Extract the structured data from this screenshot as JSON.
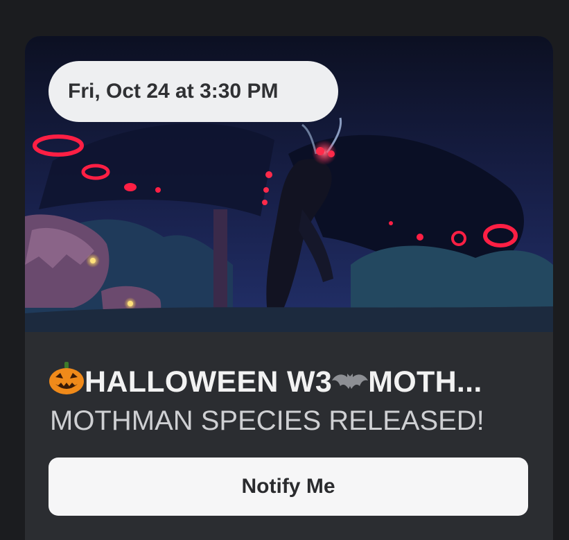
{
  "event": {
    "date_label": "Fri, Oct 24 at 3:30 PM",
    "title_prefix_icon": "jack-o-lantern-icon",
    "title_part1": "HALLOWEEN W3",
    "title_mid_icon": "bat-icon",
    "title_part2": " MOTH...",
    "subtitle": "MOTHMAN SPECIES RELEASED!",
    "cta_label": "Notify Me"
  },
  "colors": {
    "page_bg": "#1b1c1f",
    "card_bg": "#2b2d31",
    "pill_bg": "#eeeff1",
    "button_bg": "#f6f6f7",
    "glow_red": "#ff2a4a"
  }
}
